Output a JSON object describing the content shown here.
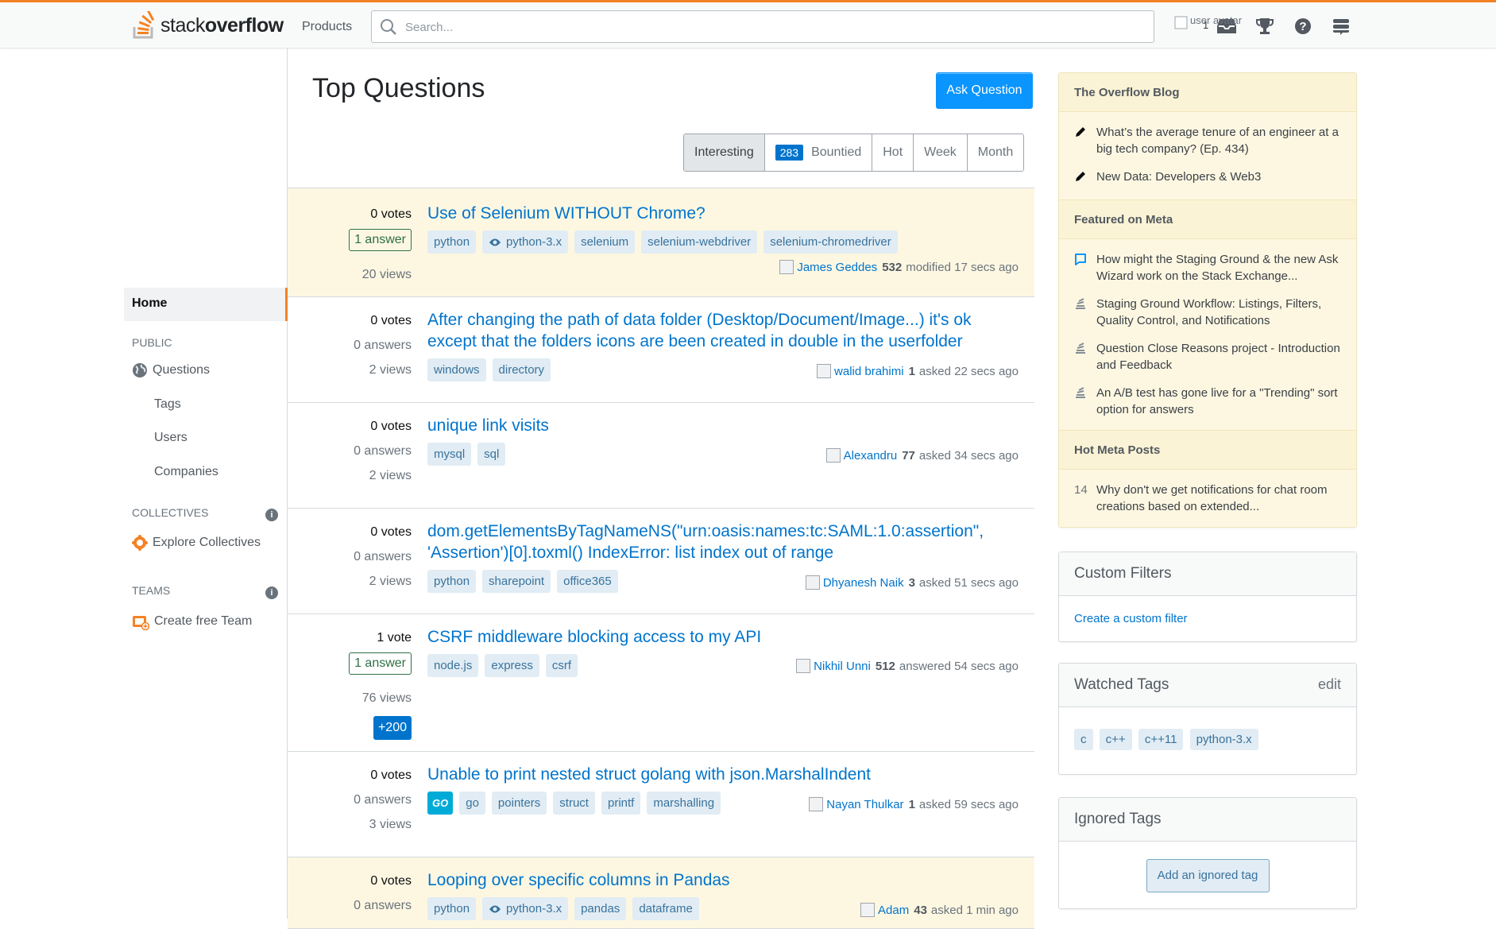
{
  "header": {
    "logo_text_a": "stack",
    "logo_text_b": "overflow",
    "products": "Products",
    "search_placeholder": "Search...",
    "avatar_alt": "user avatar",
    "avatar_rep": "1"
  },
  "leftnav": {
    "home": "Home",
    "public": "PUBLIC",
    "questions": "Questions",
    "tags": "Tags",
    "users": "Users",
    "companies": "Companies",
    "collectives": "COLLECTIVES",
    "explore_collectives": "Explore Collectives",
    "teams": "TEAMS",
    "create_team": "Create free Team"
  },
  "main": {
    "title": "Top Questions",
    "ask_button": "Ask Question",
    "filters": {
      "interesting": "Interesting",
      "bountied_count": "283",
      "bountied": "Bountied",
      "hot": "Hot",
      "week": "Week",
      "month": "Month"
    },
    "questions": [
      {
        "votes": "0 votes",
        "answers": "1 answer",
        "views": "20 views",
        "title": "Use of Selenium WITHOUT Chrome?",
        "tags": [
          "python",
          "python-3.x",
          "selenium",
          "selenium-webdriver",
          "selenium-chromedriver"
        ],
        "user": "James Geddes",
        "rep": "532",
        "action": "modified 17 secs ago"
      },
      {
        "votes": "0 votes",
        "answers": "0 answers",
        "views": "2 views",
        "title": "After changing the path of data folder (Desktop/Document/Image...) it's ok except that the folders icons are been created in double in the userfolder",
        "tags": [
          "windows",
          "directory"
        ],
        "user": "walid brahimi",
        "rep": "1",
        "action": "asked 22 secs ago"
      },
      {
        "votes": "0 votes",
        "answers": "0 answers",
        "views": "2 views",
        "title": "unique link visits",
        "tags": [
          "mysql",
          "sql"
        ],
        "user": "Alexandru",
        "rep": "77",
        "action": "asked 34 secs ago"
      },
      {
        "votes": "0 votes",
        "answers": "0 answers",
        "views": "2 views",
        "title": "dom.getElementsByTagNameNS(\"urn:oasis:names:tc:SAML:1.0:assertion\", 'Assertion')[0].toxml() IndexError: list index out of range",
        "tags": [
          "python",
          "sharepoint",
          "office365"
        ],
        "user": "Dhyanesh Naik",
        "rep": "3",
        "action": "asked 51 secs ago"
      },
      {
        "votes": "1 vote",
        "answers": "1 answer",
        "views": "76 views",
        "bounty": "+200",
        "title": "CSRF middleware blocking access to my API",
        "tags": [
          "node.js",
          "express",
          "csrf"
        ],
        "user": "Nikhil Unni",
        "rep": "512",
        "action": "answered 54 secs ago"
      },
      {
        "votes": "0 votes",
        "answers": "0 answers",
        "views": "3 views",
        "title": "Unable to print nested struct golang with json.MarshalIndent",
        "tags": [
          "go",
          "pointers",
          "struct",
          "printf",
          "marshalling"
        ],
        "user": "Nayan Thulkar",
        "rep": "1",
        "action": "asked 59 secs ago"
      },
      {
        "votes": "0 votes",
        "answers": "0 answers",
        "title": "Looping over specific columns in Pandas",
        "tags": [
          "python",
          "python-3.x",
          "pandas",
          "dataframe"
        ],
        "user": "Adam",
        "rep": "43",
        "action": "asked 1 min ago"
      }
    ]
  },
  "sidebar": {
    "blog_title": "The Overflow Blog",
    "blog_items": [
      "What’s the average tenure of an engineer at a big tech company? (Ep. 434)",
      "New Data: Developers & Web3"
    ],
    "meta_title": "Featured on Meta",
    "meta_items": [
      "How might the Staging Ground & the new Ask Wizard work on the Stack Exchange...",
      "Staging Ground Workflow: Listings, Filters, Quality Control, and Notifications",
      "Question Close Reasons project - Introduction and Feedback",
      "An A/B test has gone live for a \"Trending\" sort option for answers"
    ],
    "hot_title": "Hot Meta Posts",
    "hot_items": [
      {
        "count": "14",
        "text": "Why don't we get notifications for chat room creations based on extended..."
      }
    ],
    "custom_filters_title": "Custom Filters",
    "custom_filter_link": "Create a custom filter",
    "watched_title": "Watched Tags",
    "watched_edit": "edit",
    "watched_tags": [
      "c",
      "c++",
      "c++11",
      "python-3.x"
    ],
    "ignored_title": "Ignored Tags",
    "ignored_button": "Add an ignored tag"
  },
  "colors": {
    "accent_orange": "#f48225",
    "link_blue": "#0074cc",
    "button_blue": "#0a95ff",
    "highlight_row": "#fdf7e2",
    "tag_bg": "#e1ecf4"
  }
}
